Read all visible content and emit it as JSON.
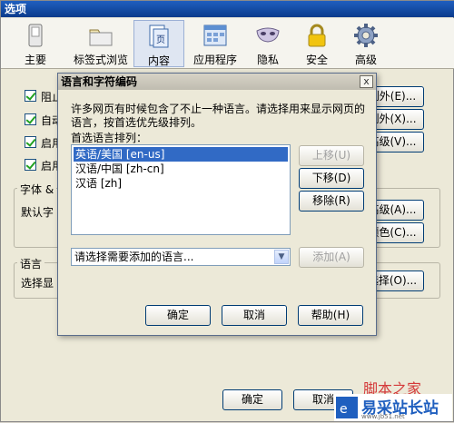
{
  "window": {
    "title": "选项",
    "toolbar": [
      {
        "label": "主要",
        "icon": "switch-icon"
      },
      {
        "label": "标签式浏览",
        "icon": "folder-icon"
      },
      {
        "label": "内容",
        "icon": "page-icon"
      },
      {
        "label": "应用程序",
        "icon": "applications-icon"
      },
      {
        "label": "隐私",
        "icon": "mask-icon"
      },
      {
        "label": "安全",
        "icon": "lock-icon"
      },
      {
        "label": "高级",
        "icon": "gear-icon"
      }
    ],
    "selected_tab": "内容",
    "checkboxes": [
      "阻止",
      "自动",
      "启用",
      "启用"
    ],
    "right_buttons": [
      "例外(E)...",
      "例外(X)...",
      "高级(V)..."
    ],
    "fonts_group": {
      "title": "字体 &",
      "row": "默认字",
      "buttons": [
        "高级(A)...",
        "颜色(C)..."
      ]
    },
    "lang_group": {
      "title": "语言",
      "row": "选择显",
      "button": "选择(O)..."
    },
    "bottom_buttons": {
      "ok": "确定",
      "cancel": "取消"
    }
  },
  "dialog": {
    "title": "语言和字符编码",
    "close": "x",
    "description": "许多网页有时候包含了不止一种语言。请选择用来显示网页的语言，按首选优先级排列。",
    "desc_line1": "许多网页有时候包含了不止一种语言。请选择用来显示网页的",
    "desc_line2": "语言，按首选优先级排列。",
    "list_label": "首选语言排列：",
    "languages": [
      "英语/美国  [en-us]",
      "汉语/中国  [zh-cn]",
      "汉语  [zh]"
    ],
    "buttons": {
      "up": "上移(U)",
      "down": "下移(D)",
      "remove": "移除(R)",
      "add": "添加(A)"
    },
    "select_placeholder": "请选择需要添加的语言...",
    "footer": {
      "ok": "确定",
      "cancel": "取消",
      "help": "帮助(H)"
    }
  },
  "watermark": {
    "line1": "脚本之家",
    "brand": "易采站长站",
    "url": "www.jb51.net"
  }
}
